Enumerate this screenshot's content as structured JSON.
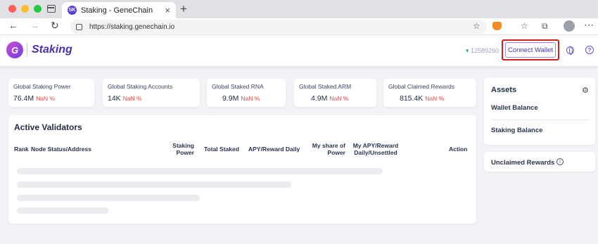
{
  "browser": {
    "tab_title": "Staking - GeneChain",
    "tab_favicon": "SK",
    "url": "https://staking.genechain.io"
  },
  "header": {
    "brand": "Staking",
    "logo_letter": "G",
    "block_number": "12589260",
    "connect_label": "Connect Wallet"
  },
  "stats": [
    {
      "label": "Global Staking Power",
      "value": "76.4M",
      "change": "NaN %"
    },
    {
      "label": "Global Staking Accounts",
      "value": "14K",
      "change": "NaN %"
    },
    {
      "label": "Global Staked RNA",
      "value": "9.9M",
      "change": "NaN %"
    },
    {
      "label": "Global Staked ARM",
      "value": "4.9M",
      "change": "NaN %"
    },
    {
      "label": "Global Claimed Rewards",
      "value": "815.4K",
      "change": "NaN %"
    }
  ],
  "validators": {
    "title": "Active Validators",
    "columns": {
      "rank": "Rank",
      "node": "Node Status/Address",
      "power": "Staking\nPower",
      "staked": "Total Staked",
      "apy": "APY/Reward Daily",
      "share": "My share of\nPower",
      "my_apy": "My APY/Reward\nDaily/Unsettled",
      "action": "Action"
    }
  },
  "assets": {
    "title": "Assets",
    "wallet_balance": "Wallet Balance",
    "staking_balance": "Staking Balance",
    "unclaimed_rewards": "Unclaimed Rewards"
  },
  "colors": {
    "accent": "#4a2fb5",
    "highlight_border": "#d21d1d",
    "nan": "#e34b4b"
  }
}
